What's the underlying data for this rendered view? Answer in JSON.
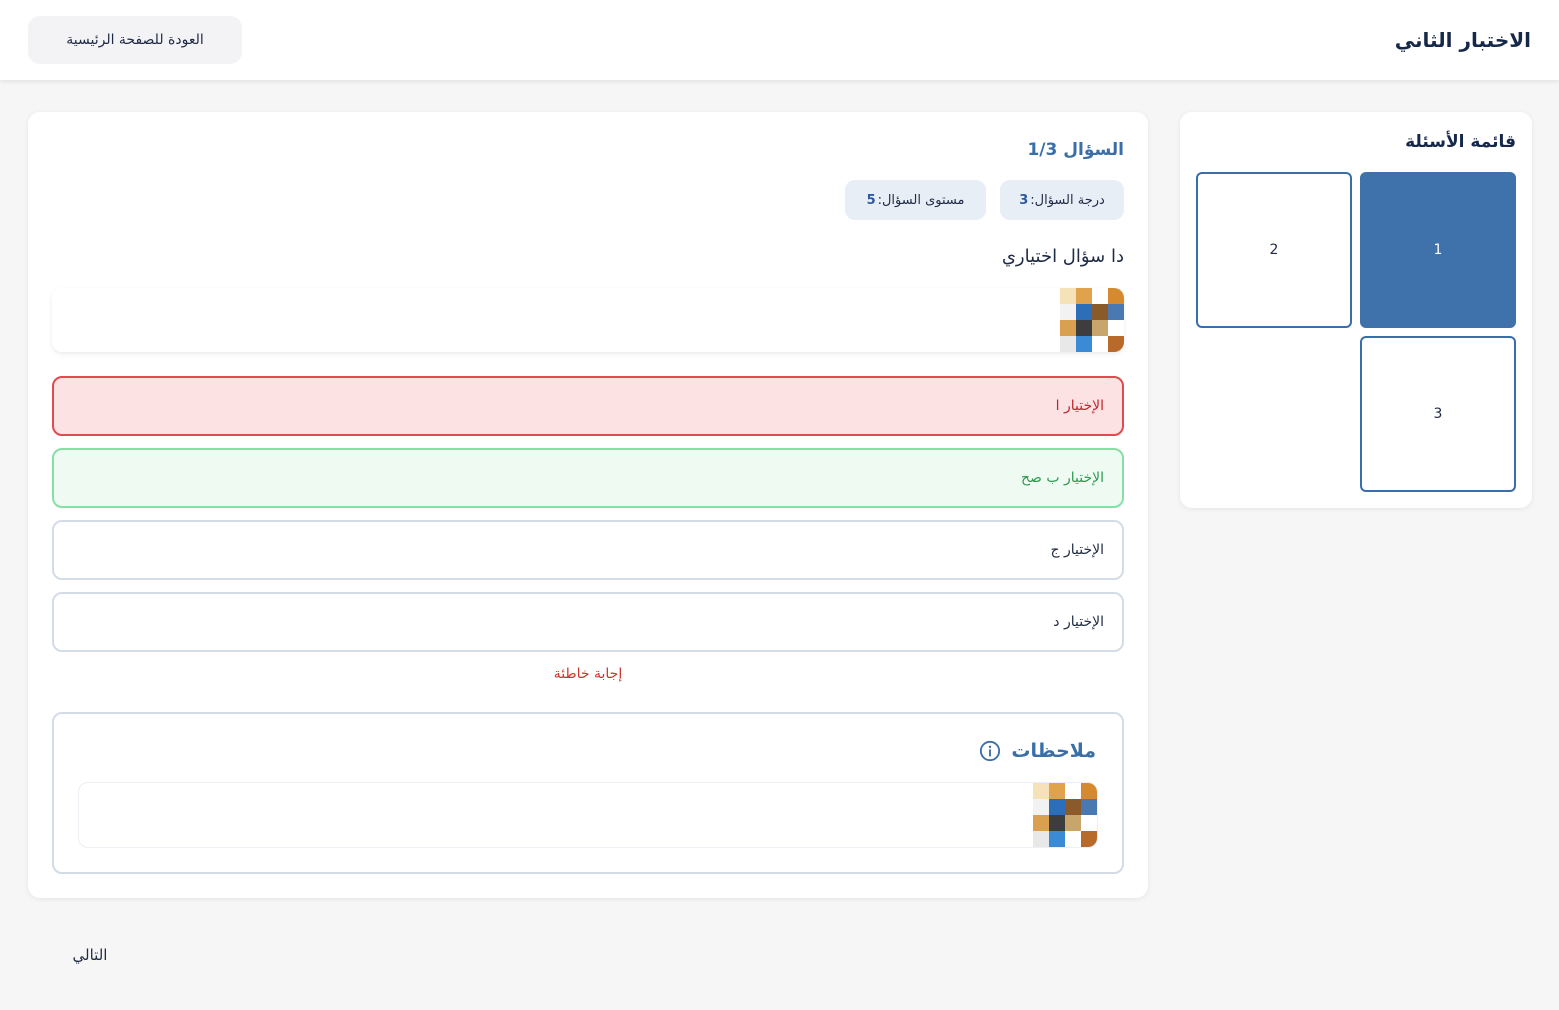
{
  "header": {
    "title": "الاختبار الثاني",
    "home_button": "العودة للصفحة الرئيسية"
  },
  "question": {
    "title": "السؤال 1/3",
    "degree_label": "درجة السؤال:",
    "degree_value": "3",
    "level_label": "مستوى السؤال:",
    "level_value": "5",
    "text": "دا سؤال اختياري"
  },
  "options": [
    {
      "label": "الإختيار ا",
      "state": "wrong"
    },
    {
      "label": "الإختيار ب صح",
      "state": "correct"
    },
    {
      "label": "الإختيار ج",
      "state": "neutral"
    },
    {
      "label": "الإختيار د",
      "state": "neutral"
    }
  ],
  "result_text": "إجابة خاطئة",
  "notes": {
    "title": "ملاحظات",
    "icon": "info-icon"
  },
  "sidebar": {
    "title": "قائمة الأسئلة",
    "questions": [
      {
        "number": "1",
        "active": true
      },
      {
        "number": "2",
        "active": false
      },
      {
        "number": "3",
        "active": false
      }
    ]
  },
  "footer": {
    "next_button": "التالي"
  },
  "colors": {
    "accent": "#3f71ab",
    "wrong": "#e04b50",
    "correct": "#86e0a6",
    "result": "#d0312d"
  }
}
